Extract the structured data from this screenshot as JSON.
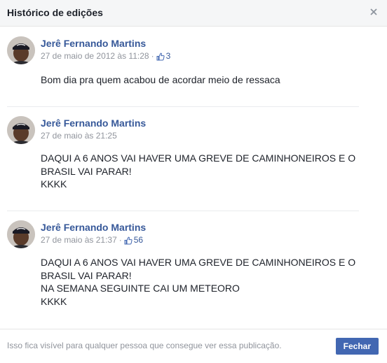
{
  "dialog": {
    "title": "Histórico de edições",
    "close_icon": "close-icon",
    "footer_note": "Isso fica visível para qualquer pessoa que consegue ver essa publicação.",
    "close_button_label": "Fechar"
  },
  "entries": [
    {
      "author": "Jerê Fernando Martins",
      "date": "27 de maio de 2012 às 11:28",
      "separator": "·",
      "like_icon": "thumbs-up-icon",
      "likes": "3",
      "text": "Bom dia pra quem acabou de acordar meio de ressaca"
    },
    {
      "author": "Jerê Fernando Martins",
      "date": "27 de maio às 21:25",
      "text": "DAQUI A 6 ANOS VAI HAVER UMA GREVE DE CAMINHONEIROS E O\nBRASIL VAI PARAR!\nKKKK"
    },
    {
      "author": "Jerê Fernando Martins",
      "date": "27 de maio às 21:37",
      "separator": "·",
      "like_icon": "thumbs-up-icon",
      "likes": "56",
      "text": "DAQUI A 6 ANOS VAI HAVER UMA GREVE DE CAMINHONEIROS E O\nBRASIL VAI PARAR!\nNA SEMANA SEGUINTE CAI UM METEORO\nKKKK"
    }
  ],
  "colors": {
    "link": "#365899",
    "muted": "#90949c",
    "button": "#4267b2",
    "header_bg": "#f5f6f7"
  }
}
